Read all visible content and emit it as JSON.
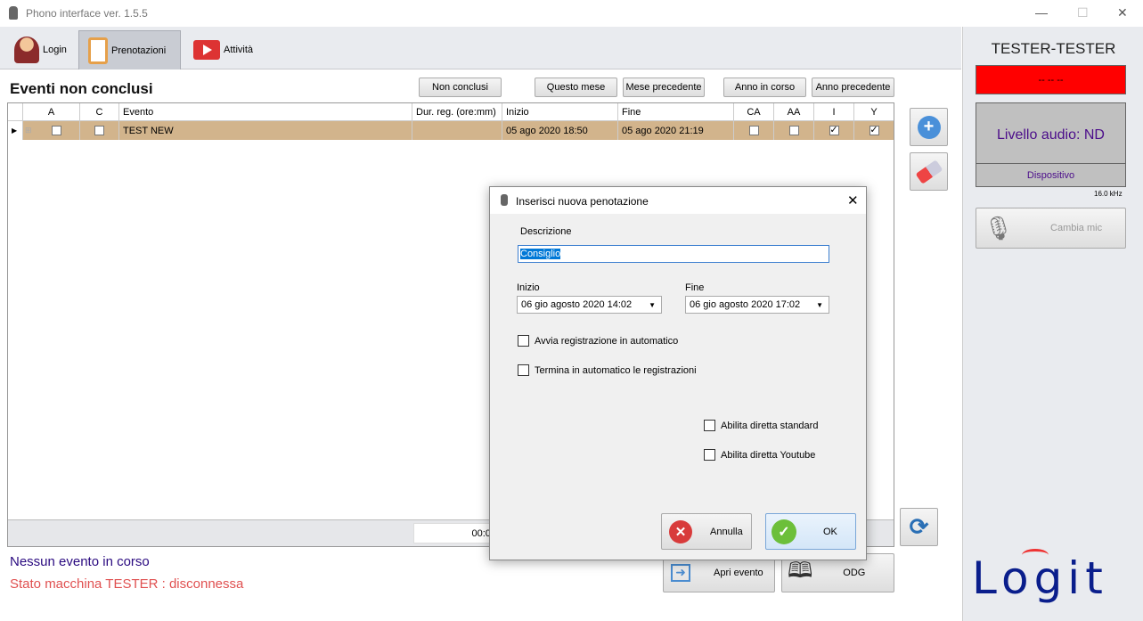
{
  "window": {
    "title": "Phono interface ver. 1.5.5",
    "minimize": "—",
    "maximize": "☐",
    "close": "✕"
  },
  "tabs": [
    {
      "label": "Login",
      "icon": "user-key-icon"
    },
    {
      "label": "Prenotazioni",
      "icon": "clipboard-icon"
    },
    {
      "label": "Attività",
      "icon": "play-icon"
    }
  ],
  "main": {
    "title": "Eventi non conclusi",
    "filters": [
      "Non conclusi",
      "Questo mese",
      "Mese precedente",
      "Anno in corso",
      "Anno precedente"
    ],
    "columns": [
      "A",
      "C",
      "Evento",
      "Dur. reg. (ore:mm)",
      "Inizio",
      "Fine",
      "CA",
      "AA",
      "I",
      "Y"
    ],
    "rows": [
      {
        "evento": "TEST NEW",
        "dur": "",
        "inizio": "05 ago 2020 18:50",
        "fine": "05 ago 2020 21:19",
        "A": false,
        "C": false,
        "CA": false,
        "AA": false,
        "I": true,
        "Y": true
      }
    ],
    "footer_time": "00:00",
    "status_event": "Nessun evento in corso",
    "status_machine": "Stato macchina TESTER : disconnessa",
    "open_event": "Apri evento",
    "odg": "ODG"
  },
  "right": {
    "user": "TESTER-TESTER",
    "timer": "-- -- --",
    "audio_level": "Livello audio: ND",
    "device": "Dispositivo",
    "rate": "16.0 kHz",
    "change_mic": "Cambia mic",
    "logo": "Logit",
    "colors": {
      "timer_bg": "#ff0000",
      "logo": "#0a1e8c"
    }
  },
  "dialog": {
    "title": "Inserisci nuova penotazione",
    "desc_label": "Descrizione",
    "desc_value": "Consiglio",
    "start_label": "Inizio",
    "start_value": "06 gio agosto 2020 14:02",
    "end_label": "Fine",
    "end_value": "06 gio agosto 2020 17:02",
    "auto_start": "Avvia registrazione in automatico",
    "auto_end": "Termina in automatico le registrazioni",
    "live_std": "Abilita diretta standard",
    "live_yt": "Abilita diretta Youtube",
    "cancel": "Annulla",
    "ok": "OK"
  }
}
